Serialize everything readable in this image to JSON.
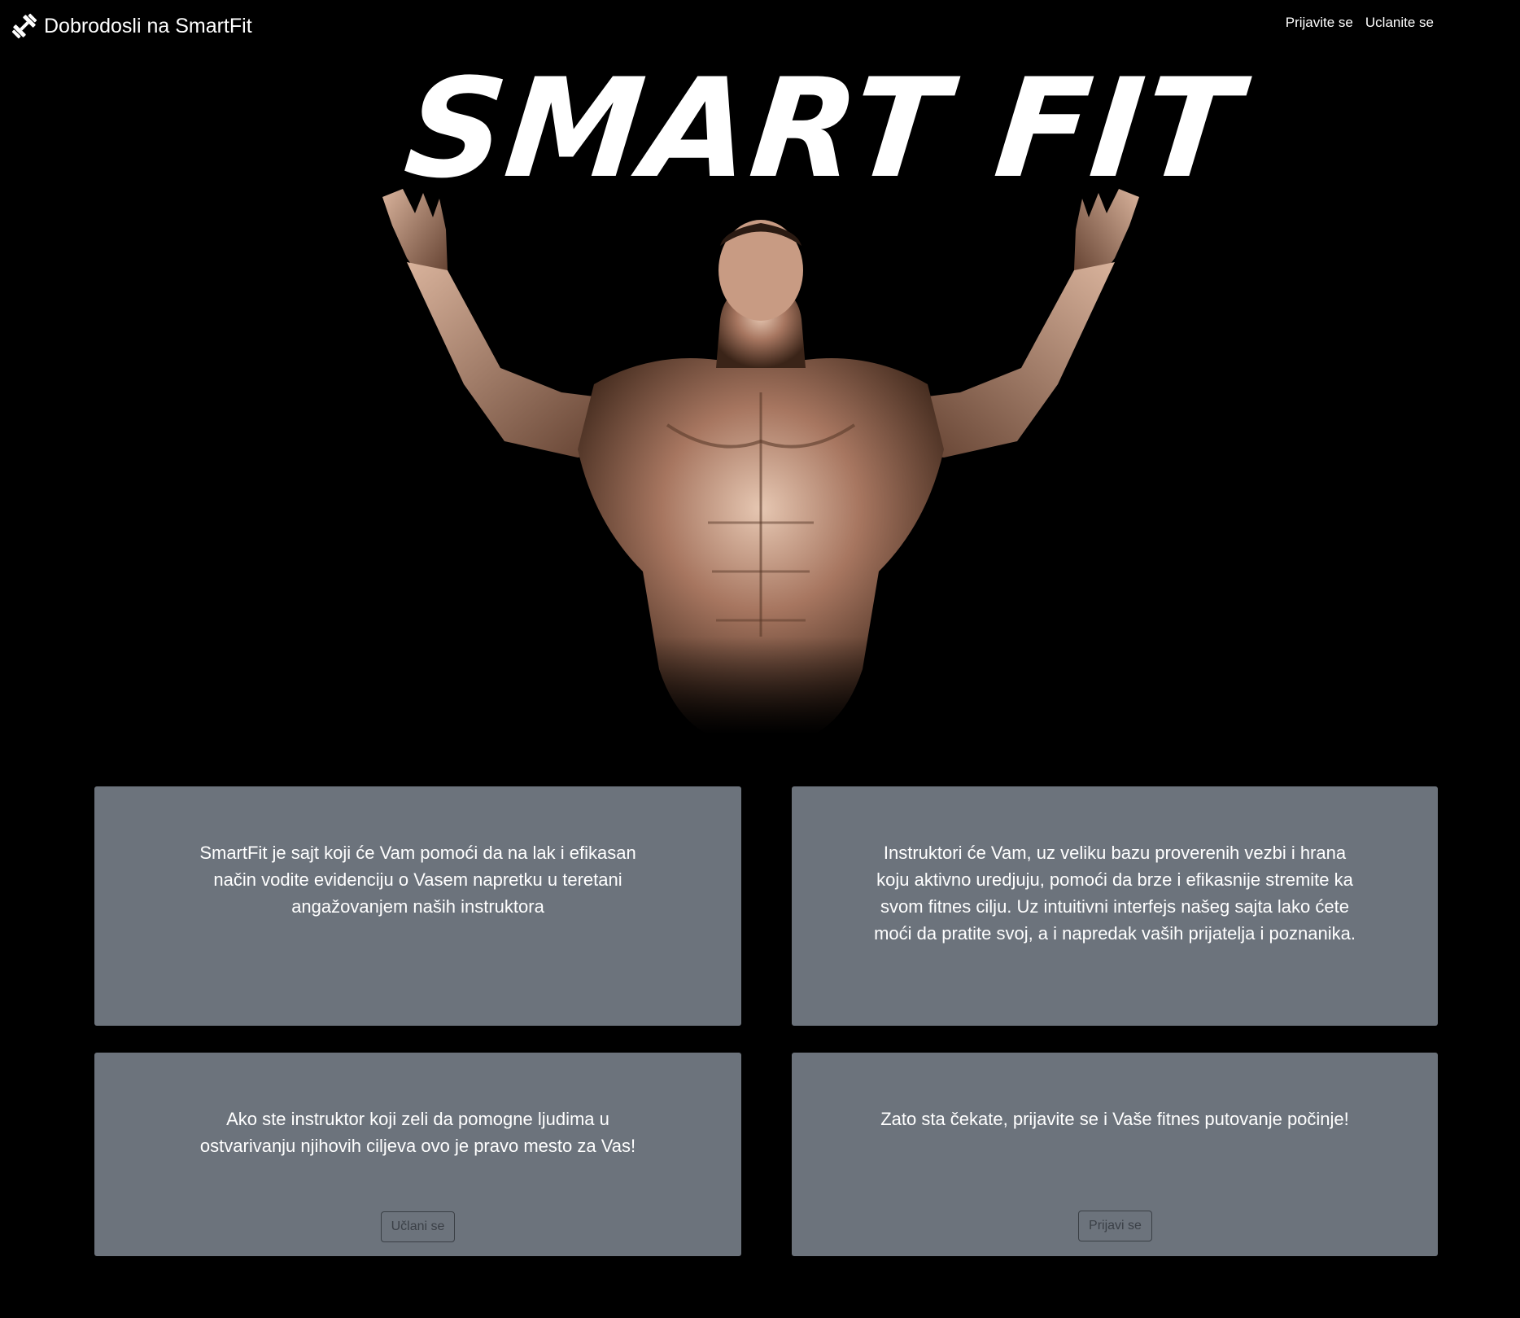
{
  "navbar": {
    "brand_icon": "dumbbell-icon",
    "brand_text": "Dobrodosli na SmartFit",
    "links": [
      {
        "label": "Prijavite se"
      },
      {
        "label": "Uclanite se"
      }
    ]
  },
  "hero": {
    "title": "SMART FIT",
    "image": "bodybuilder-photo"
  },
  "cards": [
    {
      "text": "SmartFit je sajt koji će Vam pomoći da na lak i efikasan način vodite evidenciju o Vasem napretku u teretani angažovanjem naših instruktora"
    },
    {
      "text": "Instruktori će Vam, uz veliku bazu proverenih vezbi i hrana koju aktivno uredjuju, pomoći da brze i efikasnije stremite ka svom fitnes cilju. Uz intuitivni interfejs našeg sajta lako ćete moći da pratite svoj, a i napredak vaših prijatelja i poznanika."
    },
    {
      "text": "Ako ste instruktor koji zeli da pomogne ljudima u ostvarivanju njihovih ciljeva ovo je pravo mesto za Vas!",
      "button": "Učlani se"
    },
    {
      "text": "Zato sta čekate, prijavite se i Vaše fitnes putovanje počinje!",
      "button": "Prijavi se"
    }
  ],
  "colors": {
    "background": "#000000",
    "card": "#6c737c",
    "text": "#ffffff"
  }
}
